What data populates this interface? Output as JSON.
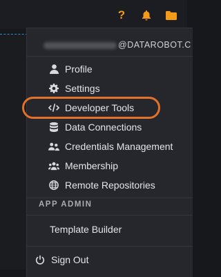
{
  "header": {
    "help_icon_label": "?",
    "icons": [
      "help-icon",
      "bell-icon",
      "folder-icon"
    ],
    "accent_color": "#f39a19"
  },
  "account": {
    "email_visible": "@DATAROBOT.C"
  },
  "menu": {
    "items": [
      {
        "label": "Profile",
        "icon": "user-icon"
      },
      {
        "label": "Settings",
        "icon": "gear-icon"
      },
      {
        "label": "Developer Tools",
        "icon": "code-icon"
      },
      {
        "label": "Data Connections",
        "icon": "database-icon"
      },
      {
        "label": "Credentials Management",
        "icon": "users-key-icon"
      },
      {
        "label": "Membership",
        "icon": "group-icon"
      },
      {
        "label": "Remote Repositories",
        "icon": "globe-icon"
      }
    ],
    "section_app_admin": "APP ADMIN",
    "template_builder": "Template Builder",
    "sign_out": "Sign Out",
    "highlight_color": "#e2712b"
  }
}
